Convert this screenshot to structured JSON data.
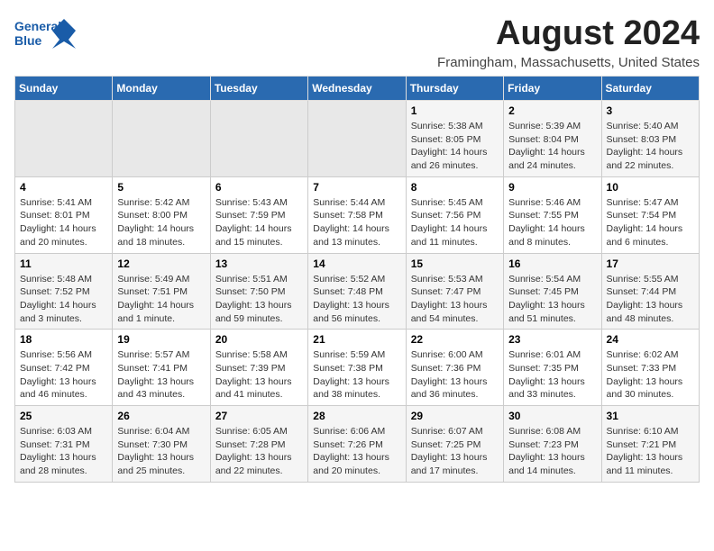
{
  "header": {
    "logo_general": "General",
    "logo_blue": "Blue",
    "month_year": "August 2024",
    "location": "Framingham, Massachusetts, United States"
  },
  "weekdays": [
    "Sunday",
    "Monday",
    "Tuesday",
    "Wednesday",
    "Thursday",
    "Friday",
    "Saturday"
  ],
  "weeks": [
    [
      {
        "day": "",
        "info": ""
      },
      {
        "day": "",
        "info": ""
      },
      {
        "day": "",
        "info": ""
      },
      {
        "day": "",
        "info": ""
      },
      {
        "day": "1",
        "info": "Sunrise: 5:38 AM\nSunset: 8:05 PM\nDaylight: 14 hours\nand 26 minutes."
      },
      {
        "day": "2",
        "info": "Sunrise: 5:39 AM\nSunset: 8:04 PM\nDaylight: 14 hours\nand 24 minutes."
      },
      {
        "day": "3",
        "info": "Sunrise: 5:40 AM\nSunset: 8:03 PM\nDaylight: 14 hours\nand 22 minutes."
      }
    ],
    [
      {
        "day": "4",
        "info": "Sunrise: 5:41 AM\nSunset: 8:01 PM\nDaylight: 14 hours\nand 20 minutes."
      },
      {
        "day": "5",
        "info": "Sunrise: 5:42 AM\nSunset: 8:00 PM\nDaylight: 14 hours\nand 18 minutes."
      },
      {
        "day": "6",
        "info": "Sunrise: 5:43 AM\nSunset: 7:59 PM\nDaylight: 14 hours\nand 15 minutes."
      },
      {
        "day": "7",
        "info": "Sunrise: 5:44 AM\nSunset: 7:58 PM\nDaylight: 14 hours\nand 13 minutes."
      },
      {
        "day": "8",
        "info": "Sunrise: 5:45 AM\nSunset: 7:56 PM\nDaylight: 14 hours\nand 11 minutes."
      },
      {
        "day": "9",
        "info": "Sunrise: 5:46 AM\nSunset: 7:55 PM\nDaylight: 14 hours\nand 8 minutes."
      },
      {
        "day": "10",
        "info": "Sunrise: 5:47 AM\nSunset: 7:54 PM\nDaylight: 14 hours\nand 6 minutes."
      }
    ],
    [
      {
        "day": "11",
        "info": "Sunrise: 5:48 AM\nSunset: 7:52 PM\nDaylight: 14 hours\nand 3 minutes."
      },
      {
        "day": "12",
        "info": "Sunrise: 5:49 AM\nSunset: 7:51 PM\nDaylight: 14 hours\nand 1 minute."
      },
      {
        "day": "13",
        "info": "Sunrise: 5:51 AM\nSunset: 7:50 PM\nDaylight: 13 hours\nand 59 minutes."
      },
      {
        "day": "14",
        "info": "Sunrise: 5:52 AM\nSunset: 7:48 PM\nDaylight: 13 hours\nand 56 minutes."
      },
      {
        "day": "15",
        "info": "Sunrise: 5:53 AM\nSunset: 7:47 PM\nDaylight: 13 hours\nand 54 minutes."
      },
      {
        "day": "16",
        "info": "Sunrise: 5:54 AM\nSunset: 7:45 PM\nDaylight: 13 hours\nand 51 minutes."
      },
      {
        "day": "17",
        "info": "Sunrise: 5:55 AM\nSunset: 7:44 PM\nDaylight: 13 hours\nand 48 minutes."
      }
    ],
    [
      {
        "day": "18",
        "info": "Sunrise: 5:56 AM\nSunset: 7:42 PM\nDaylight: 13 hours\nand 46 minutes."
      },
      {
        "day": "19",
        "info": "Sunrise: 5:57 AM\nSunset: 7:41 PM\nDaylight: 13 hours\nand 43 minutes."
      },
      {
        "day": "20",
        "info": "Sunrise: 5:58 AM\nSunset: 7:39 PM\nDaylight: 13 hours\nand 41 minutes."
      },
      {
        "day": "21",
        "info": "Sunrise: 5:59 AM\nSunset: 7:38 PM\nDaylight: 13 hours\nand 38 minutes."
      },
      {
        "day": "22",
        "info": "Sunrise: 6:00 AM\nSunset: 7:36 PM\nDaylight: 13 hours\nand 36 minutes."
      },
      {
        "day": "23",
        "info": "Sunrise: 6:01 AM\nSunset: 7:35 PM\nDaylight: 13 hours\nand 33 minutes."
      },
      {
        "day": "24",
        "info": "Sunrise: 6:02 AM\nSunset: 7:33 PM\nDaylight: 13 hours\nand 30 minutes."
      }
    ],
    [
      {
        "day": "25",
        "info": "Sunrise: 6:03 AM\nSunset: 7:31 PM\nDaylight: 13 hours\nand 28 minutes."
      },
      {
        "day": "26",
        "info": "Sunrise: 6:04 AM\nSunset: 7:30 PM\nDaylight: 13 hours\nand 25 minutes."
      },
      {
        "day": "27",
        "info": "Sunrise: 6:05 AM\nSunset: 7:28 PM\nDaylight: 13 hours\nand 22 minutes."
      },
      {
        "day": "28",
        "info": "Sunrise: 6:06 AM\nSunset: 7:26 PM\nDaylight: 13 hours\nand 20 minutes."
      },
      {
        "day": "29",
        "info": "Sunrise: 6:07 AM\nSunset: 7:25 PM\nDaylight: 13 hours\nand 17 minutes."
      },
      {
        "day": "30",
        "info": "Sunrise: 6:08 AM\nSunset: 7:23 PM\nDaylight: 13 hours\nand 14 minutes."
      },
      {
        "day": "31",
        "info": "Sunrise: 6:10 AM\nSunset: 7:21 PM\nDaylight: 13 hours\nand 11 minutes."
      }
    ]
  ]
}
